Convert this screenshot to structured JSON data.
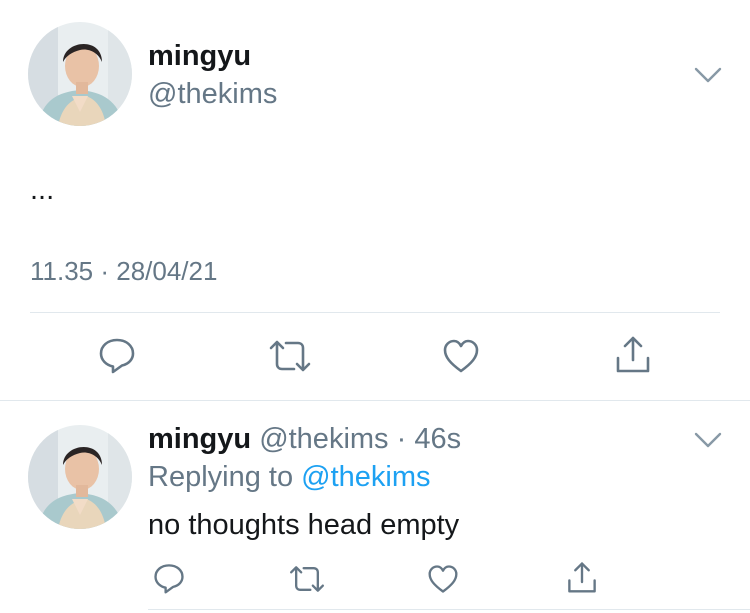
{
  "main_tweet": {
    "display_name": "mingyu",
    "handle": "@thekims",
    "text": "...",
    "timestamp": "11.35 · 28/04/21"
  },
  "reply": {
    "display_name": "mingyu",
    "handle": "@thekims",
    "separator": " · ",
    "age": "46s",
    "replying_prefix": "Replying to ",
    "replying_handle": "@thekims",
    "text": "no thoughts head empty"
  },
  "icons": {
    "menu": "chevron-down-icon",
    "reply": "reply-icon",
    "retweet": "retweet-icon",
    "like": "heart-icon",
    "share": "share-icon"
  },
  "colors": {
    "text": "#14171a",
    "secondary": "#657786",
    "link": "#1da1f2",
    "divider": "#e1e8ed"
  }
}
